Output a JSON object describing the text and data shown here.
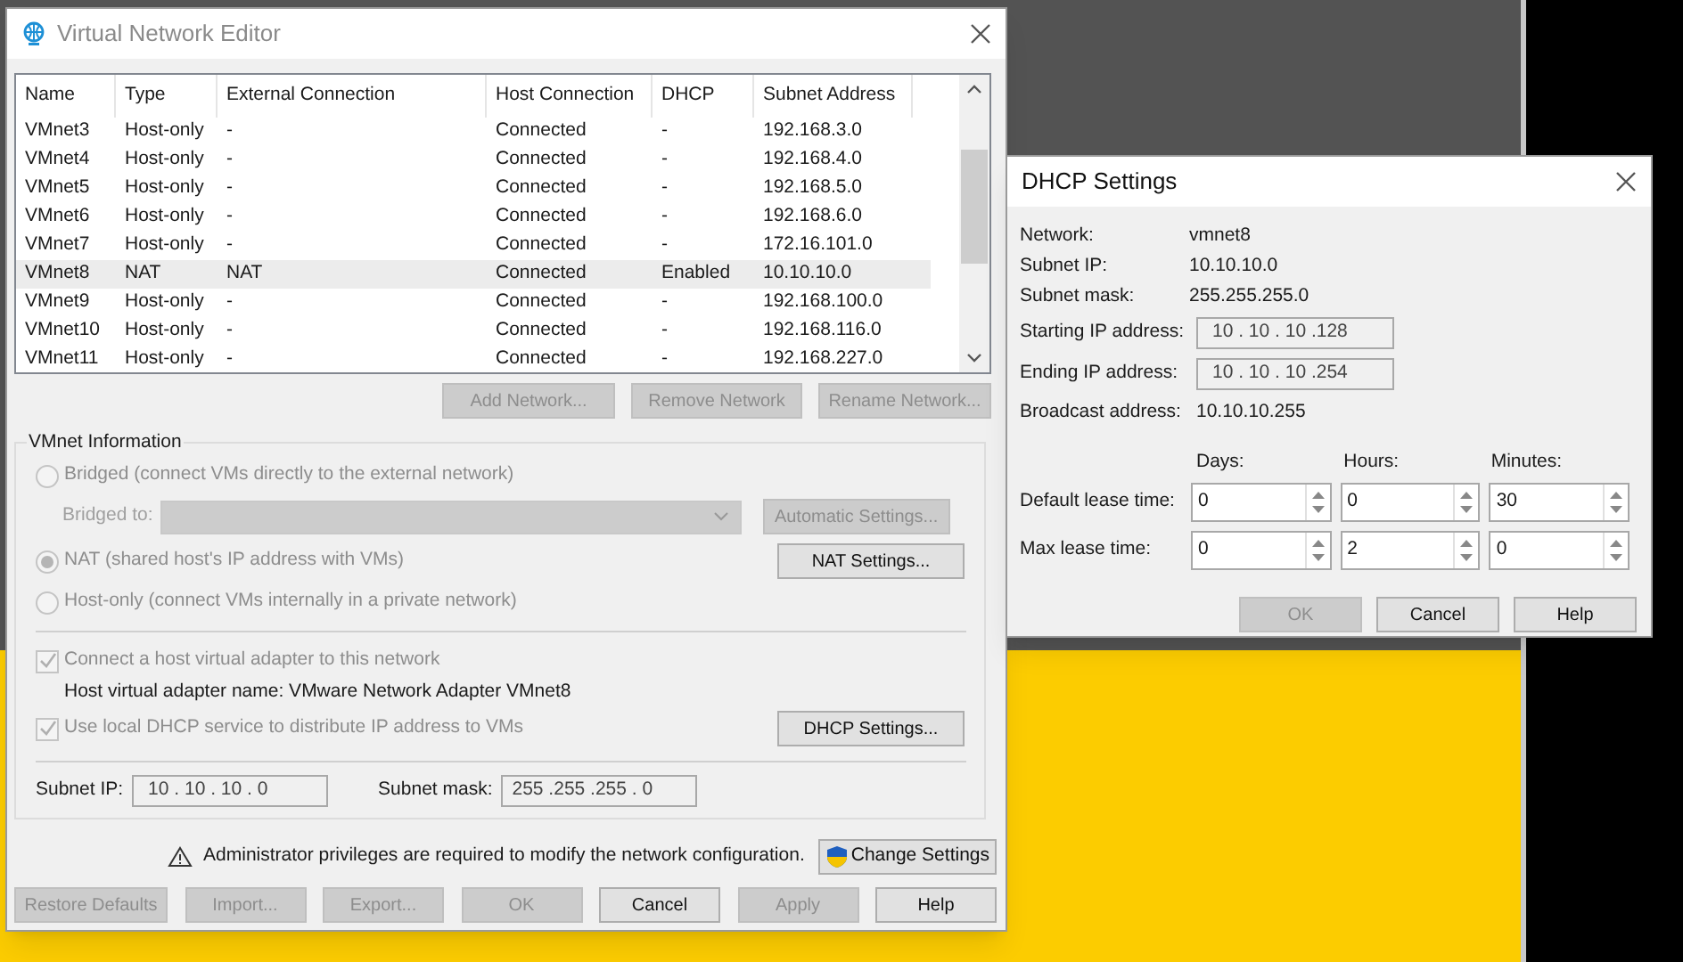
{
  "main_window": {
    "title": "Virtual Network Editor",
    "table": {
      "columns": [
        "Name",
        "Type",
        "External Connection",
        "Host Connection",
        "DHCP",
        "Subnet Address"
      ],
      "rows": [
        {
          "cells": [
            "VMnet3",
            "Host-only",
            "-",
            "Connected",
            "-",
            "192.168.3.0"
          ],
          "selected": false
        },
        {
          "cells": [
            "VMnet4",
            "Host-only",
            "-",
            "Connected",
            "-",
            "192.168.4.0"
          ],
          "selected": false
        },
        {
          "cells": [
            "VMnet5",
            "Host-only",
            "-",
            "Connected",
            "-",
            "192.168.5.0"
          ],
          "selected": false
        },
        {
          "cells": [
            "VMnet6",
            "Host-only",
            "-",
            "Connected",
            "-",
            "192.168.6.0"
          ],
          "selected": false
        },
        {
          "cells": [
            "VMnet7",
            "Host-only",
            "-",
            "Connected",
            "-",
            "172.16.101.0"
          ],
          "selected": false
        },
        {
          "cells": [
            "VMnet8",
            "NAT",
            "NAT",
            "Connected",
            "Enabled",
            "10.10.10.0"
          ],
          "selected": true
        },
        {
          "cells": [
            "VMnet9",
            "Host-only",
            "-",
            "Connected",
            "-",
            "192.168.100.0"
          ],
          "selected": false
        },
        {
          "cells": [
            "VMnet10",
            "Host-only",
            "-",
            "Connected",
            "-",
            "192.168.116.0"
          ],
          "selected": false
        },
        {
          "cells": [
            "VMnet11",
            "Host-only",
            "-",
            "Connected",
            "-",
            "192.168.227.0"
          ],
          "selected": false
        }
      ]
    },
    "table_buttons": [
      {
        "label": "Add Network...",
        "disabled": true
      },
      {
        "label": "Remove Network",
        "disabled": true
      },
      {
        "label": "Rename Network...",
        "disabled": true
      }
    ],
    "vmnet_information": {
      "title": "VMnet Information",
      "bridged": {
        "label": "Bridged (connect VMs directly to the external network)",
        "selected": false,
        "disabled": true
      },
      "bridged_to": {
        "label": "Bridged to:",
        "disabled": true
      },
      "automatic_settings": {
        "label": "Automatic Settings...",
        "disabled": true
      },
      "nat": {
        "label": "NAT (shared host's IP address with VMs)",
        "selected": true,
        "disabled": true
      },
      "nat_settings": {
        "label": "NAT Settings...",
        "disabled": false
      },
      "host_only": {
        "label": "Host-only (connect VMs internally in a private network)",
        "selected": false,
        "disabled": true
      },
      "connect_adapter": {
        "label": "Connect a host virtual adapter to this network",
        "checked": true,
        "disabled": true
      },
      "adapter_name": "Host virtual adapter name: VMware Network Adapter VMnet8",
      "use_dhcp": {
        "label": "Use local DHCP service to distribute IP address to VMs",
        "checked": true,
        "disabled": true
      },
      "dhcp_settings": {
        "label": "DHCP Settings...",
        "disabled": false
      },
      "subnet_ip": {
        "label": "Subnet IP:",
        "value": "10 . 10 . 10 . 0"
      },
      "subnet_mask": {
        "label": "Subnet mask:",
        "value": "255 .255 .255 . 0"
      }
    },
    "warning": "Administrator privileges are required to modify the network configuration.",
    "change_settings": {
      "label": "Change Settings",
      "disabled": false
    },
    "buttons": [
      {
        "label": "Restore Defaults",
        "disabled": true
      },
      {
        "label": "Import...",
        "disabled": true
      },
      {
        "label": "Export...",
        "disabled": true
      },
      {
        "label": "OK",
        "disabled": true
      },
      {
        "label": "Cancel",
        "disabled": false
      },
      {
        "label": "Apply",
        "disabled": true
      },
      {
        "label": "Help",
        "disabled": false
      }
    ]
  },
  "dhcp_dialog": {
    "title": "DHCP Settings",
    "info": [
      {
        "label": "Network:",
        "value": "vmnet8"
      },
      {
        "label": "Subnet IP:",
        "value": "10.10.10.0"
      },
      {
        "label": "Subnet mask:",
        "value": "255.255.255.0"
      }
    ],
    "ranges": [
      {
        "label": "Starting IP address:",
        "value": "10 . 10 . 10 .128"
      },
      {
        "label": "Ending IP address:",
        "value": "10 . 10 . 10 .254"
      }
    ],
    "broadcast": {
      "label": "Broadcast address:",
      "value": "10.10.10.255"
    },
    "lease_columns": [
      "Days:",
      "Hours:",
      "Minutes:"
    ],
    "leases": [
      {
        "label": "Default lease time:",
        "values": [
          "0",
          "0",
          "30"
        ]
      },
      {
        "label": "Max lease time:",
        "values": [
          "0",
          "2",
          "0"
        ]
      }
    ],
    "buttons": [
      {
        "label": "OK",
        "disabled": true
      },
      {
        "label": "Cancel",
        "disabled": false
      },
      {
        "label": "Help",
        "disabled": false
      }
    ]
  }
}
